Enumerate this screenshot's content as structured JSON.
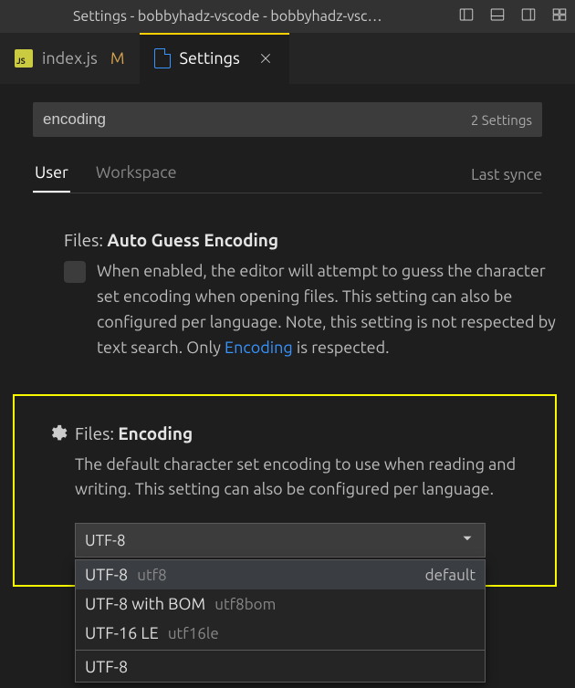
{
  "titlebar": {
    "title": "Settings - bobbyhadz-vscode - bobbyhadz-vsc…"
  },
  "tabs": [
    {
      "label": "index.js",
      "modified": "M"
    },
    {
      "label": "Settings"
    }
  ],
  "search": {
    "value": "encoding",
    "count_label": "2 Settings"
  },
  "scope": {
    "tabs": [
      "User",
      "Workspace"
    ],
    "sync_label": "Last synce"
  },
  "settings": {
    "auto_guess": {
      "prefix": "Files: ",
      "name": "Auto Guess Encoding",
      "desc_before": "When enabled, the editor will attempt to guess the character set encoding when opening files. This setting can also be configured per language. Note, this setting is not respected by text search. Only ",
      "link": "Encoding",
      "desc_after": " is respected."
    },
    "encoding": {
      "prefix": "Files: ",
      "name": "Encoding",
      "desc": "The default character set encoding to use when reading and writing. This setting can also be configured per language.",
      "selected": "UTF-8",
      "options": [
        {
          "label": "UTF-8",
          "id": "utf8",
          "right": "default",
          "selected": true
        },
        {
          "label": "UTF-8 with BOM",
          "id": "utf8bom"
        },
        {
          "label": "UTF-16 LE",
          "id": "utf16le"
        }
      ],
      "filter_value": "UTF-8"
    }
  }
}
